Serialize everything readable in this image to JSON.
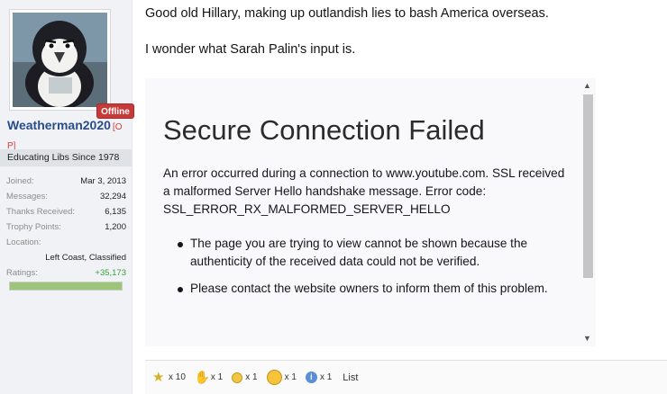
{
  "user": {
    "username": "Weatherman2020",
    "op_tag": "[OP]",
    "status": "Offline",
    "title": "Educating Libs Since 1978",
    "stats": [
      {
        "label": "Joined:",
        "value": "Mar 3, 2013"
      },
      {
        "label": "Messages:",
        "value": "32,294"
      },
      {
        "label": "Thanks Received:",
        "value": "6,135"
      },
      {
        "label": "Trophy Points:",
        "value": "1,200"
      }
    ],
    "location_label": "Location:",
    "location": "Left Coast, Classified",
    "ratings_label": "Ratings:",
    "ratings": "+35,173",
    "rating_fill": 1.0,
    "avatar_icon": "penguin-avatar"
  },
  "post": {
    "line1": "Good old Hillary, making up outlandish lies to bash America overseas.",
    "line2": "I wonder what Sarah Palin's input is."
  },
  "embed": {
    "title": "Secure Connection Failed",
    "body": "An error occurred during a connection to www.youtube.com. SSL received a malformed Server Hello handshake message. Error code: SSL_ERROR_RX_MALFORMED_SERVER_HELLO",
    "bullets": [
      "The page you are trying to view cannot be shown because the authenticity of the received data could not be verified.",
      "Please contact the website owners to inform them of this problem."
    ]
  },
  "reactions": [
    {
      "icon": "trophy-star-icon",
      "count": "x 10"
    },
    {
      "icon": "thumbs-up-icon",
      "count": "x 1"
    },
    {
      "icon": "smile-icon",
      "count": "x 1"
    },
    {
      "icon": "wink-icon",
      "count": "x 1"
    },
    {
      "icon": "info-icon",
      "count": "x 1"
    }
  ],
  "reactions_list_label": "List",
  "colors": {
    "username": "#2a4d8a",
    "offline_badge": "#c83a3a",
    "ratings_positive": "#3aa13a"
  }
}
